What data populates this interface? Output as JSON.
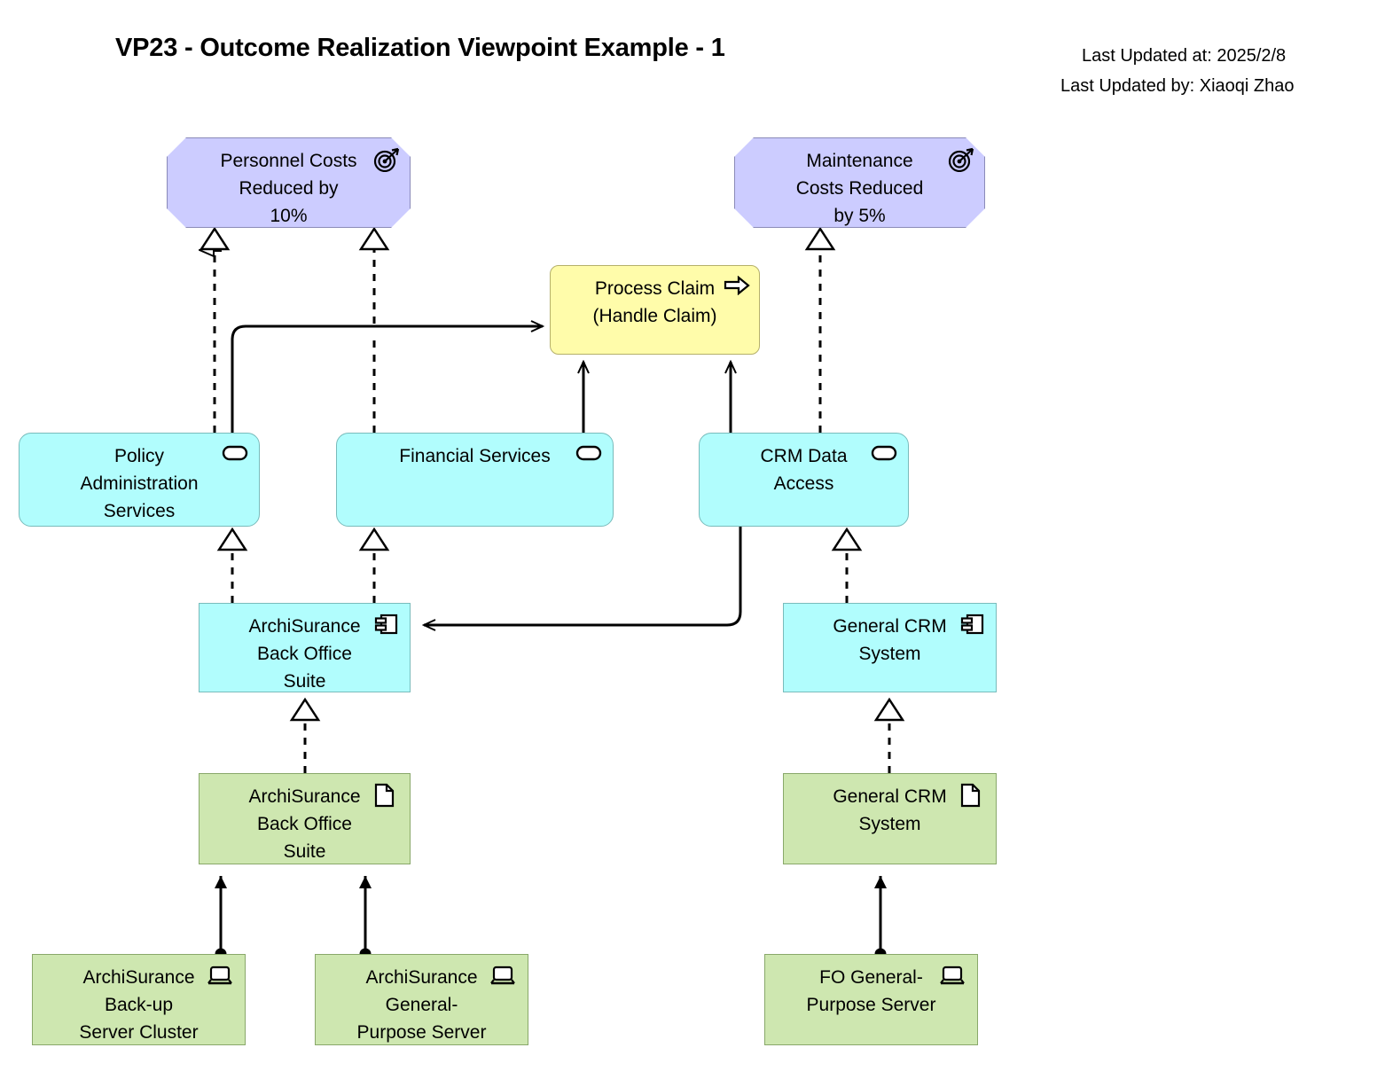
{
  "header": {
    "title": "VP23 - Outcome Realization Viewpoint Example - 1",
    "last_updated_at": "Last Updated at: 2025/2/8",
    "last_updated_by": "Last Updated by: Xiaoqi Zhao"
  },
  "palette": {
    "outcome_fill": "#ccccff",
    "outcome_stroke": "#8a8ab8",
    "process_fill": "#fffcaa",
    "process_stroke": "#b5b06a",
    "application_fill": "#b1fdfd",
    "application_stroke": "#79bbbb",
    "technology_fill": "#cee7b0",
    "technology_stroke": "#89a86a",
    "line": "#000000",
    "background": "#ffffff"
  },
  "nodes": [
    {
      "id": "personnel-costs-reduced",
      "label": "Personnel Costs\nReduced by\n10%",
      "type": "outcome",
      "icon": "target-icon"
    },
    {
      "id": "maintenance-costs-reduced",
      "label": "Maintenance\nCosts Reduced\nby 5%",
      "type": "outcome",
      "icon": "target-icon"
    },
    {
      "id": "process-claim",
      "label": "Process Claim\n(Handle Claim)",
      "type": "business-process",
      "icon": "arrow-right-icon"
    },
    {
      "id": "policy-administration-services",
      "label": "Policy\nAdministration\nServices",
      "type": "application-service",
      "icon": "rounded-rect-icon"
    },
    {
      "id": "financial-services",
      "label": "Financial Services",
      "type": "application-service",
      "icon": "rounded-rect-icon"
    },
    {
      "id": "crm-data-access",
      "label": "CRM Data\nAccess",
      "type": "application-service",
      "icon": "rounded-rect-icon"
    },
    {
      "id": "archisurance-back-office-suite-component",
      "label": "ArchiSurance\nBack Office\nSuite",
      "type": "application-component",
      "icon": "component-icon"
    },
    {
      "id": "general-crm-system-component",
      "label": "General CRM\nSystem",
      "type": "application-component",
      "icon": "component-icon"
    },
    {
      "id": "archisurance-back-office-suite-artifact",
      "label": "ArchiSurance\nBack Office\nSuite",
      "type": "artifact",
      "icon": "document-icon"
    },
    {
      "id": "general-crm-system-artifact",
      "label": "General CRM\nSystem",
      "type": "artifact",
      "icon": "document-icon"
    },
    {
      "id": "archisurance-backup-server-cluster",
      "label": "ArchiSurance\nBack-up\nServer Cluster",
      "type": "device",
      "icon": "device-icon"
    },
    {
      "id": "archisurance-general-purpose-server",
      "label": "ArchiSurance\nGeneral-\nPurpose Server",
      "type": "device",
      "icon": "device-icon"
    },
    {
      "id": "fo-general-purpose-server",
      "label": "FO General-\nPurpose Server",
      "type": "device",
      "icon": "device-icon"
    }
  ],
  "edges": [
    {
      "from": "policy-administration-services",
      "to": "personnel-costs-reduced",
      "type": "realization"
    },
    {
      "from": "financial-services",
      "to": "personnel-costs-reduced",
      "type": "realization"
    },
    {
      "from": "crm-data-access",
      "to": "maintenance-costs-reduced",
      "type": "realization"
    },
    {
      "from": "policy-administration-services",
      "to": "process-claim",
      "type": "serving"
    },
    {
      "from": "financial-services",
      "to": "process-claim",
      "type": "serving"
    },
    {
      "from": "crm-data-access",
      "to": "process-claim",
      "type": "serving"
    },
    {
      "from": "archisurance-back-office-suite-component",
      "to": "policy-administration-services",
      "type": "realization"
    },
    {
      "from": "archisurance-back-office-suite-component",
      "to": "financial-services",
      "type": "realization"
    },
    {
      "from": "general-crm-system-component",
      "to": "crm-data-access",
      "type": "realization"
    },
    {
      "from": "crm-data-access",
      "to": "archisurance-back-office-suite-component",
      "type": "serving"
    },
    {
      "from": "archisurance-back-office-suite-artifact",
      "to": "archisurance-back-office-suite-component",
      "type": "realization"
    },
    {
      "from": "general-crm-system-artifact",
      "to": "general-crm-system-component",
      "type": "realization"
    },
    {
      "from": "archisurance-backup-server-cluster",
      "to": "archisurance-back-office-suite-artifact",
      "type": "assignment"
    },
    {
      "from": "archisurance-general-purpose-server",
      "to": "archisurance-back-office-suite-artifact",
      "type": "assignment"
    },
    {
      "from": "fo-general-purpose-server",
      "to": "general-crm-system-artifact",
      "type": "assignment"
    }
  ]
}
